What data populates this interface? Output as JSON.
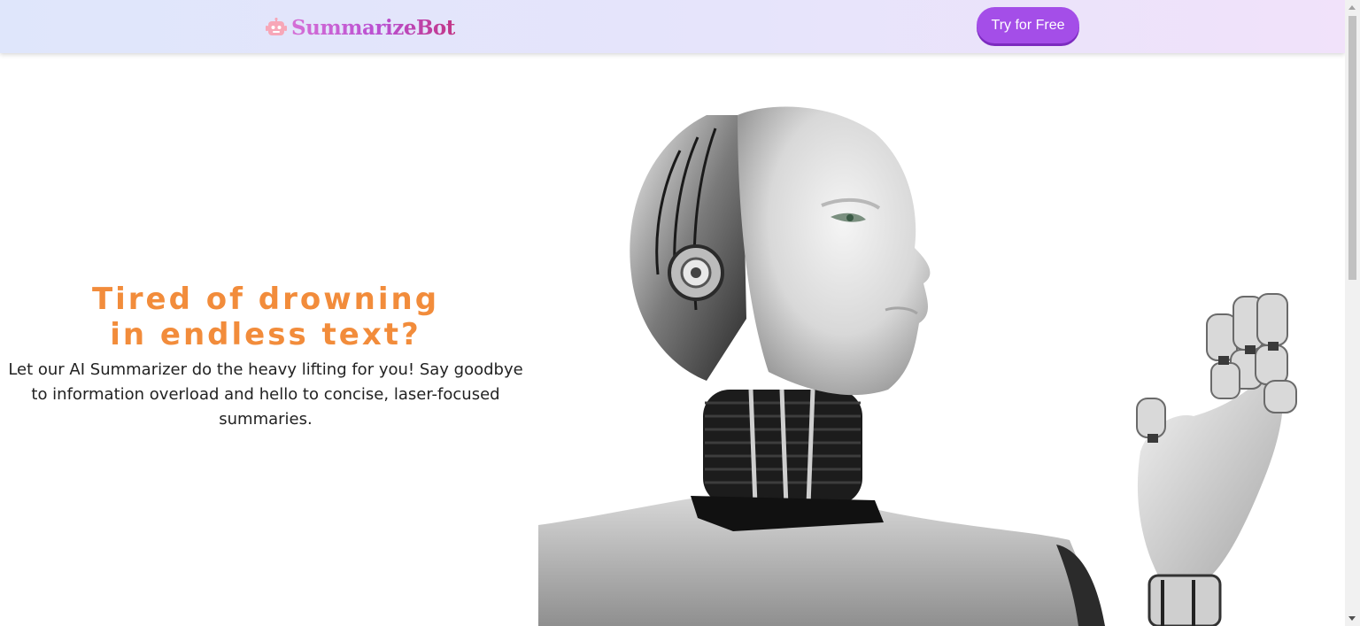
{
  "header": {
    "brand_icon": "robot-icon",
    "brand_name": "SummarizeBot",
    "cta_label": "Try for Free"
  },
  "hero": {
    "title": "Tired of drowning in endless text?",
    "subtitle": "Let our AI Summarizer do the heavy lifting for you! Say goodbye to information overload and hello to concise, laser-focused summaries.",
    "image_subject": "humanoid-robot-illustration"
  },
  "colors": {
    "accent": "#a44ee8",
    "title": "#f28c3b",
    "brand_pink": "#c33686"
  }
}
